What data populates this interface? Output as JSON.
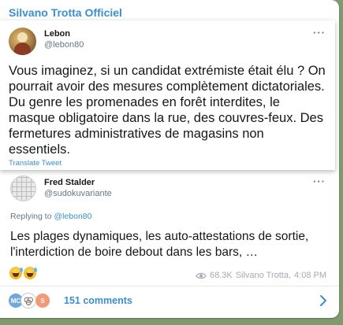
{
  "channel": {
    "name": "Silvano Trotta Officiel"
  },
  "tweet": {
    "author_name": "Lebon",
    "author_handle": "@lebon80",
    "text": "Vous imaginez, si un candidat extrémiste était élu ? On pourrait avoir des mesures complètement dictatoriales. Du genre les promenades en forêt interdites, le masque obligatoire dans la rue, des couvres-feux. Des fermetures administratives de magasins non essentiels.",
    "translate_label": "Translate Tweet",
    "more_label": "···"
  },
  "reply": {
    "author_name": "Fred Stalder",
    "author_handle": "@sudokuvariante",
    "replying_prefix": "Replying to ",
    "replying_mention": "@lebon80",
    "text": "Les plages dynamiques, les auto-attestations de sortie, l'interdiction de boire debout dans les bars, …",
    "more_label": "···"
  },
  "post_meta": {
    "views": "68.3K",
    "author": "Silvano Trotta,",
    "time": "4:08 PM"
  },
  "comments": {
    "count_label": "151 comments",
    "avatars": [
      {
        "initials": "MC",
        "color": "#6fa8dc"
      },
      {
        "initials": "",
        "icon": "sheep-icon"
      },
      {
        "initials": "S",
        "color": "#f39a74"
      }
    ]
  },
  "colors": {
    "accent": "#3a8fd4",
    "background": "#7f9a6f",
    "muted": "#657786"
  }
}
